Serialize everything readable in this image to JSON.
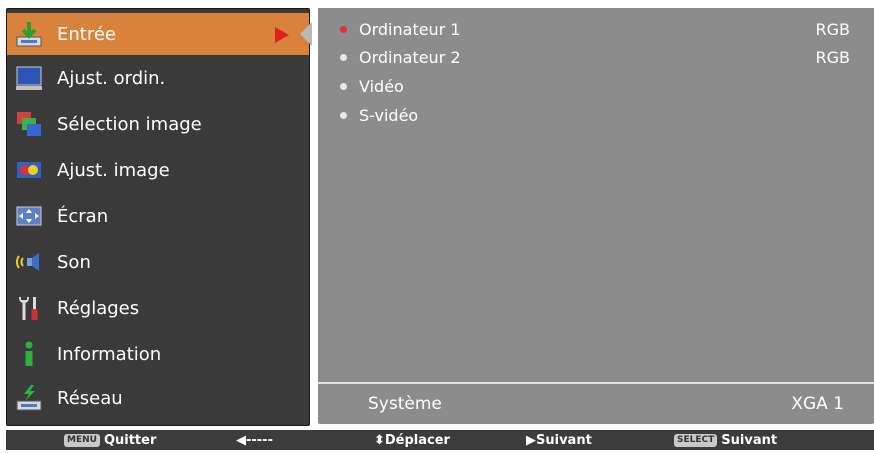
{
  "menu": {
    "items": [
      {
        "label": "Entrée",
        "icon": "input-icon",
        "selected": true
      },
      {
        "label": "Ajust. ordin.",
        "icon": "monitor-icon",
        "selected": false
      },
      {
        "label": "Sélection image",
        "icon": "image-select-icon",
        "selected": false
      },
      {
        "label": "Ajust. image",
        "icon": "image-adjust-icon",
        "selected": false
      },
      {
        "label": "Écran",
        "icon": "screen-icon",
        "selected": false
      },
      {
        "label": "Son",
        "icon": "speaker-icon",
        "selected": false
      },
      {
        "label": "Réglages",
        "icon": "settings-tools-icon",
        "selected": false
      },
      {
        "label": "Information",
        "icon": "info-icon",
        "selected": false
      },
      {
        "label": "Réseau",
        "icon": "network-icon",
        "selected": false
      }
    ]
  },
  "options": [
    {
      "label": "Ordinateur 1",
      "value": "RGB",
      "active": true
    },
    {
      "label": "Ordinateur 2",
      "value": "RGB",
      "active": false
    },
    {
      "label": "Vidéo",
      "value": "",
      "active": false
    },
    {
      "label": "S-vidéo",
      "value": "",
      "active": false
    }
  ],
  "system": {
    "label": "Système",
    "value": "XGA 1"
  },
  "bottom_bar": {
    "menu_key": "MENU",
    "quit": "Quitter",
    "back_arrow": "◀-----",
    "move": "⬍Déplacer",
    "next1": "▶Suivant",
    "select_key": "SELECT",
    "next2": "Suivant"
  },
  "colors": {
    "selected": "#d9823c",
    "menu_bg": "#3a3a3a",
    "panel_bg": "#8c8c8c",
    "accent_red": "#e02020"
  }
}
